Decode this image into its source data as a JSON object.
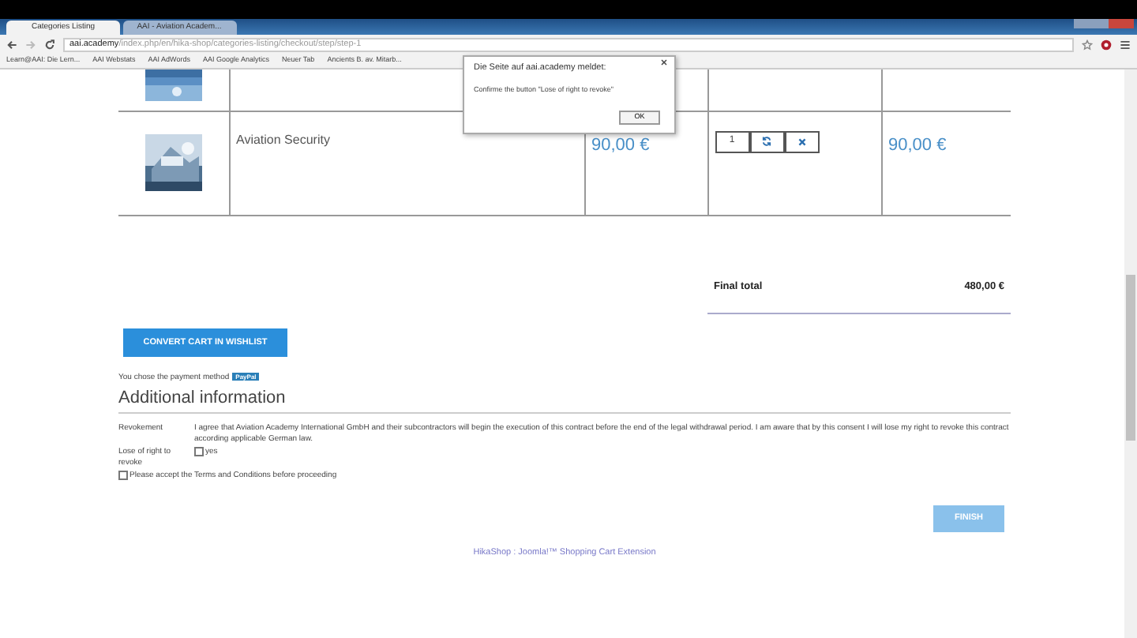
{
  "browser": {
    "tabs": [
      {
        "label": "Categories Listing",
        "selected": true
      },
      {
        "label": "AAI - Aviation Academ...",
        "selected": false
      }
    ],
    "address_host": "aai.academy",
    "address_path": "/index.php/en/hika-shop/categories-listing/checkout/step/step-1",
    "bookmarks": [
      "Learn@AAI: Die Lern...",
      "AAI Webstats",
      "AAI AdWords",
      "AAI Google Analytics",
      "Neuer Tab",
      "Ancients B. av. Mitarb..."
    ]
  },
  "alert": {
    "title": "Die Seite auf aai.academy meldet:",
    "message": "Confirme the button \"Lose of right to revoke\"",
    "button": "OK"
  },
  "cart": {
    "rows": [
      {
        "kind": "cut"
      },
      {
        "kind": "item",
        "name": "Aviation Security",
        "price": "90,00 €",
        "quantity": "1",
        "total": "90,00 €"
      }
    ],
    "final_total": {
      "label": "Final total",
      "value": "480,00 €"
    }
  },
  "convert_button": "CONVERT CART IN WISHLIST",
  "payment": {
    "text": "You chose the payment method",
    "badge": "PayPal"
  },
  "heading": "Additional information",
  "revocation": {
    "label": "Revokement",
    "text": "I agree that Aviation Academy International GmbH and their subcontractors will begin the execution of this contract before the end of the legal withdrawal period. I am aware that by this consent I will lose my right to revoke this contract according applicable German law.",
    "checkbox_label": "Lose of right to revoke",
    "option": "yes",
    "checked": false
  },
  "terms": {
    "text": "Please accept the Terms and Conditions before proceeding",
    "checked": false
  },
  "finish": {
    "label": "FINISH",
    "disabled": true
  },
  "footer": "HikaShop : Joomla!™ Shopping Cart Extension"
}
